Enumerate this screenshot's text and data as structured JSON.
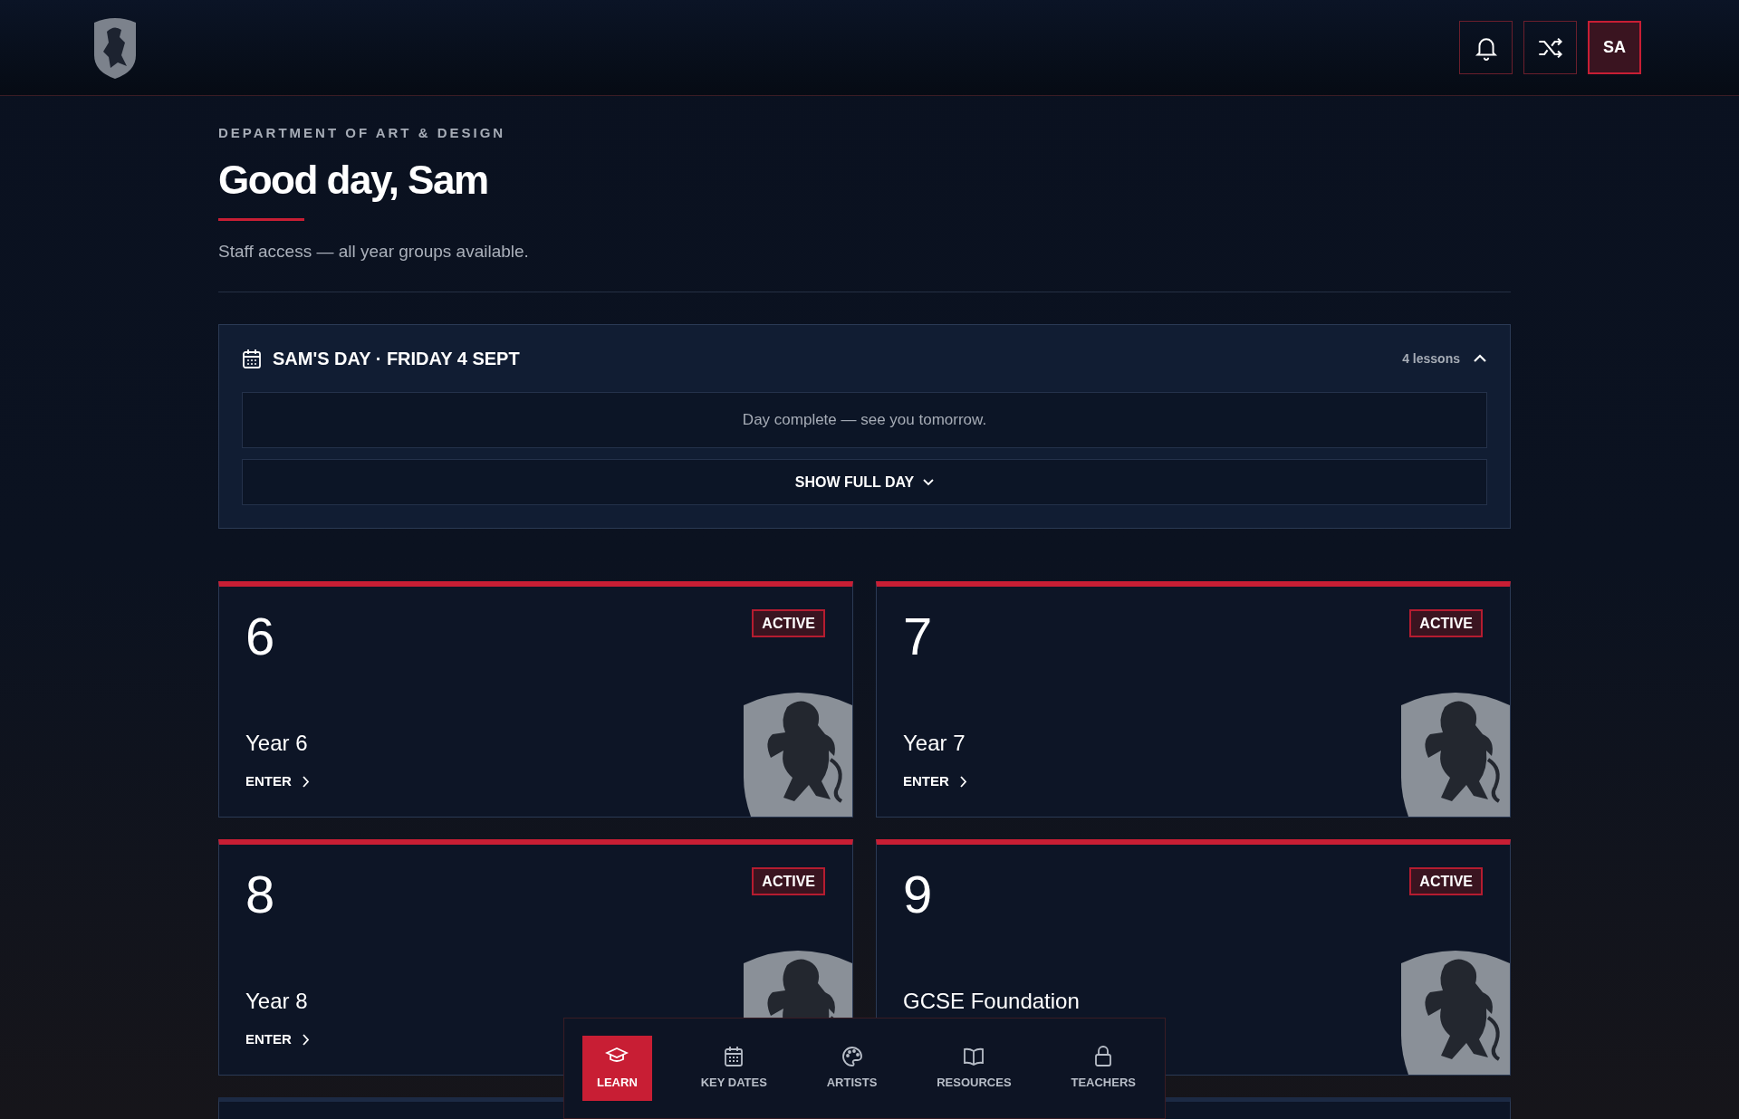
{
  "header": {
    "avatar": "SA"
  },
  "intro": {
    "eyebrow": "DEPARTMENT OF ART & DESIGN",
    "title": "Good day, Sam",
    "subtitle": "Staff access — all year groups available."
  },
  "schedule": {
    "title": "SAM'S DAY · FRIDAY 4 SEPT",
    "count": "4 lessons",
    "expanded": true,
    "message": "Day complete — see you tomorrow.",
    "toggle": "SHOW FULL DAY"
  },
  "years": [
    {
      "number": "6",
      "name": "Year 6",
      "status": "ACTIVE",
      "action": "ENTER"
    },
    {
      "number": "7",
      "name": "Year 7",
      "status": "ACTIVE",
      "action": "ENTER"
    },
    {
      "number": "8",
      "name": "Year 8",
      "status": "ACTIVE",
      "action": "ENTER"
    },
    {
      "number": "9",
      "name": "GCSE Foundation",
      "status": "ACTIVE"
    }
  ],
  "bottom_nav": [
    {
      "label": "LEARN",
      "kind": "cap",
      "selected": true
    },
    {
      "label": "KEY DATES",
      "kind": "calendar",
      "selected": false
    },
    {
      "label": "ARTISTS",
      "kind": "palette",
      "selected": false
    },
    {
      "label": "RESOURCES",
      "kind": "book",
      "selected": false
    },
    {
      "label": "TEACHERS",
      "kind": "lock",
      "selected": false
    }
  ]
}
